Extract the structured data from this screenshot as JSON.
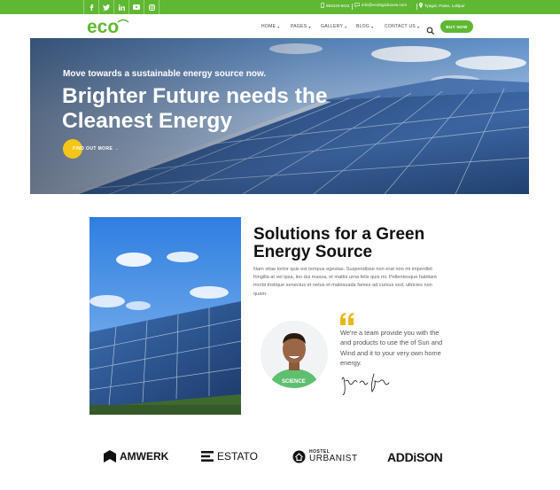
{
  "topbar": {
    "social": [
      "facebook-icon",
      "twitter-icon",
      "linkedin-icon",
      "youtube-icon",
      "instagram-icon"
    ],
    "phone": "984343-5611",
    "email": "info@ecologicboxes.com",
    "location": "Tyagal, Patan, Lalitpur"
  },
  "header": {
    "logo": "eco",
    "nav": [
      {
        "label": "HOME"
      },
      {
        "label": "PAGES"
      },
      {
        "label": "GALLERY"
      },
      {
        "label": "BLOG"
      },
      {
        "label": "CONTACT US"
      }
    ],
    "buy_label": "BUY NOW"
  },
  "hero": {
    "pretitle": "Move towards a sustainable energy source now.",
    "title": "Brighter Future needs the Cleanest Energy",
    "cta_label": "FIND OUT MORE →"
  },
  "solutions": {
    "title": "Solutions for a Green Energy Source",
    "text": "Nam vitae tortor quis est tempus egestas. Suspendisse non erat non mi imperdiet fringilla at vel ipsa, leo dui massa, et mattis urna felis quis mi. Pellentesque habitant morbi tristique senectus et netus et malesuada fames ad cursus sed, ultricies non quam.",
    "quote": "We're a team provide you with the and products to use the of Sun and Wind and it to your very own home energy.",
    "avatar_shirt": "SCIENCE"
  },
  "brands": [
    "AMWERK",
    "ESTATO",
    "HOSTEL",
    "URBANIST",
    "ADDiSON"
  ],
  "colors": {
    "brand_green": "#5fb832",
    "accent_yellow": "#f5c518"
  }
}
